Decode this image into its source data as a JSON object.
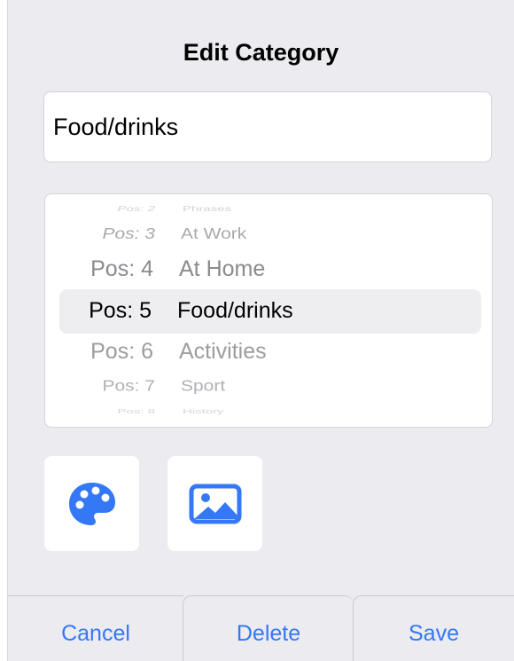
{
  "dialog": {
    "title": "Edit Category"
  },
  "name_field": {
    "value": "Food/drinks"
  },
  "picker": {
    "rows": [
      {
        "pos": "Pos: 2",
        "name": "Phrases"
      },
      {
        "pos": "Pos: 3",
        "name": "At Work"
      },
      {
        "pos": "Pos: 4",
        "name": "At Home"
      },
      {
        "pos": "Pos: 5",
        "name": "Food/drinks"
      },
      {
        "pos": "Pos: 6",
        "name": "Activities"
      },
      {
        "pos": "Pos: 7",
        "name": "Sport"
      },
      {
        "pos": "Pos: 8",
        "name": "History"
      }
    ],
    "selected_index": 3
  },
  "tiles": {
    "color_icon": "palette-icon",
    "image_icon": "photo-icon"
  },
  "buttons": {
    "cancel": "Cancel",
    "delete": "Delete",
    "save": "Save"
  },
  "colors": {
    "accent": "#3478f6",
    "background": "#ebebf0"
  }
}
